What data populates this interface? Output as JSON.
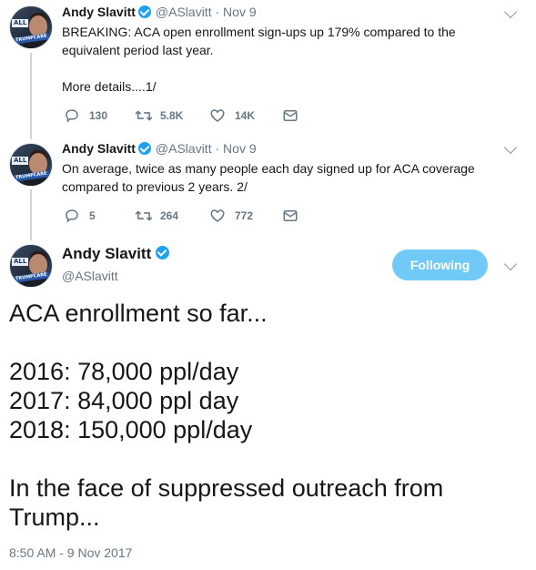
{
  "tweets": [
    {
      "name": "Andy Slavitt",
      "handle": "@ASlavitt",
      "separator": "·",
      "date": "Nov 9",
      "text_lines": [
        "BREAKING: ACA open enrollment sign-ups up 179% compared to the",
        "equivalent period last year.",
        "",
        "More details....1/"
      ],
      "replies": "130",
      "retweets": "5.8K",
      "likes": "14K"
    },
    {
      "name": "Andy Slavitt",
      "handle": "@ASlavitt",
      "separator": "·",
      "date": "Nov 9",
      "text_lines": [
        "On average, twice as many people each day signed up for ACA coverage",
        "compared to previous 2 years. 2/"
      ],
      "replies": "5",
      "retweets": "264",
      "likes": "772"
    }
  ],
  "main_tweet": {
    "name": "Andy Slavitt",
    "handle": "@ASlavitt",
    "follow_button": "Following",
    "text": "ACA enrollment so far...\n\n2016: 78,000 ppl/day\n2017: 84,000 ppl day\n2018: 150,000 ppl/day\n\nIn the face of suppressed outreach from\nTrump...",
    "timestamp": "8:50 AM - 9 Nov 2017"
  },
  "avatar": {
    "tag": "ALL",
    "tag2": "TRUMPCARE"
  },
  "icons": {
    "reply": "reply-icon",
    "retweet": "retweet-icon",
    "like": "heart-icon",
    "message": "envelope-icon",
    "verified": "verified-badge-icon",
    "menu": "chevron-down-icon"
  },
  "colors": {
    "accent": "#1da1f2",
    "follow_button": "#71c9f8",
    "secondary_text": "#657786",
    "thread_line": "#ccd6dd"
  }
}
